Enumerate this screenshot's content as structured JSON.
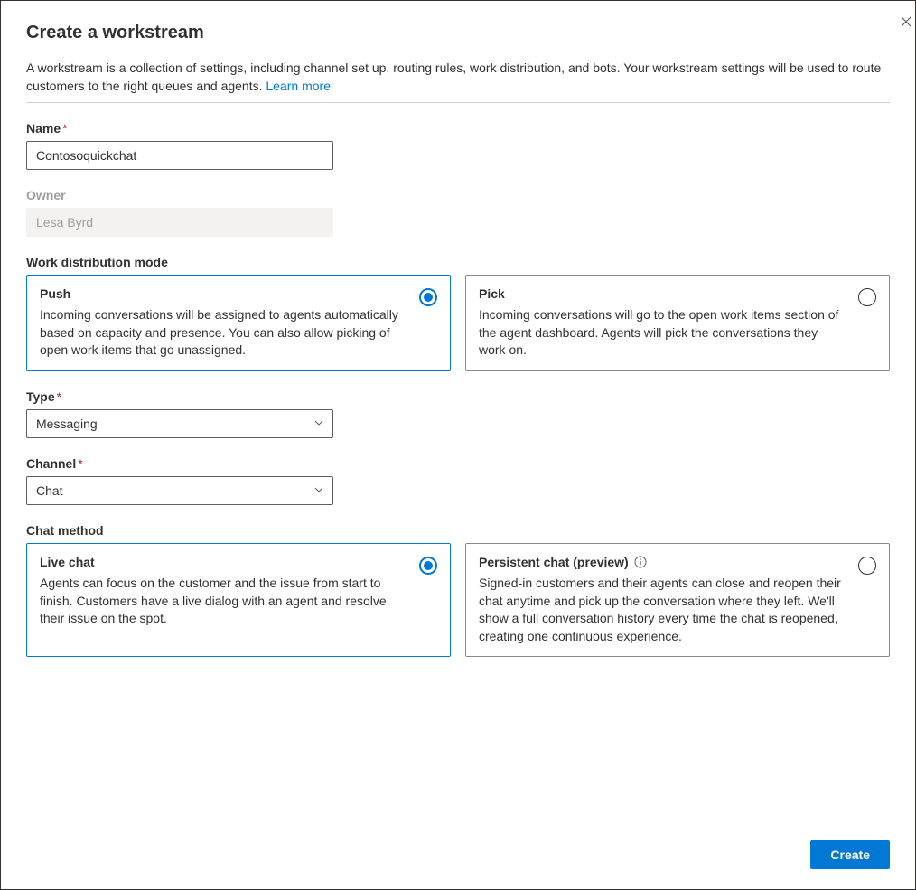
{
  "header": {
    "title": "Create a workstream",
    "description_prefix": "A workstream is a collection of settings, including channel set up, routing rules, work distribution, and bots. Your workstream settings will be used to route customers to the right queues and agents. ",
    "learn_more": "Learn more"
  },
  "fields": {
    "name": {
      "label": "Name",
      "value": "Contosoquickchat"
    },
    "owner": {
      "label": "Owner",
      "value": "Lesa Byrd"
    },
    "distribution": {
      "label": "Work distribution mode",
      "push": {
        "title": "Push",
        "desc": "Incoming conversations will be assigned to agents automatically based on capacity and presence. You can also allow picking of open work items that go unassigned.",
        "selected": true
      },
      "pick": {
        "title": "Pick",
        "desc": "Incoming conversations will go to the open work items section of the agent dashboard. Agents will pick the conversations they work on.",
        "selected": false
      }
    },
    "type": {
      "label": "Type",
      "value": "Messaging"
    },
    "channel": {
      "label": "Channel",
      "value": "Chat"
    },
    "chat_method": {
      "label": "Chat method",
      "live": {
        "title": "Live chat",
        "desc": "Agents can focus on the customer and the issue from start to finish. Customers have a live dialog with an agent and resolve their issue on the spot.",
        "selected": true
      },
      "persistent": {
        "title": "Persistent chat (preview)",
        "desc": "Signed-in customers and their agents can close and reopen their chat anytime and pick up the conversation where they left. We'll show a full conversation history every time the chat is reopened, creating one continuous experience.",
        "selected": false
      }
    }
  },
  "footer": {
    "create": "Create"
  }
}
